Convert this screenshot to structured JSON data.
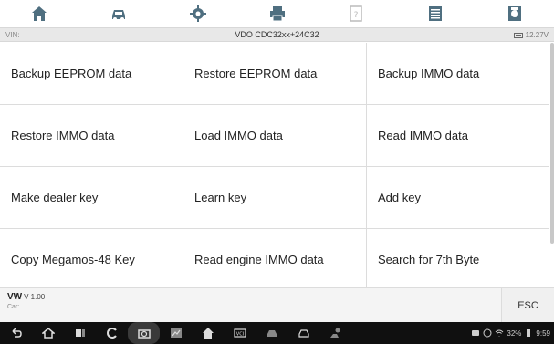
{
  "toolbar": {
    "icons": [
      "home-icon",
      "vehicle-swap-icon",
      "settings-icon",
      "print-icon",
      "help-icon",
      "data-log-icon",
      "save-icon"
    ],
    "icon_color": "#5a7a8a"
  },
  "infobar": {
    "vin_label": "VIN:",
    "title": "VDO CDC32xx+24C32",
    "voltage": "12.27V"
  },
  "menu": {
    "rows": [
      [
        "Backup EEPROM data",
        "Restore EEPROM data",
        "Backup IMMO data"
      ],
      [
        "Restore IMMO data",
        "Load IMMO data",
        "Read IMMO data"
      ],
      [
        "Make dealer key",
        "Learn key",
        "Add key"
      ],
      [
        "Copy Megamos-48 Key",
        "Read engine IMMO data",
        "Search for 7th Byte"
      ]
    ]
  },
  "bottom": {
    "make": "VW",
    "version": "V 1.00",
    "car_label": "Car:",
    "esc_label": "ESC"
  },
  "navbar": {
    "icons": [
      "back-icon",
      "home-icon",
      "recent-apps-icon",
      "browser-icon",
      "camera-icon",
      "screenshot-icon",
      "maxiap-home-icon",
      "vci-icon",
      "vehicle-icon",
      "car-icon",
      "remote-icon"
    ],
    "status_text": "32%",
    "time": "9:59"
  }
}
